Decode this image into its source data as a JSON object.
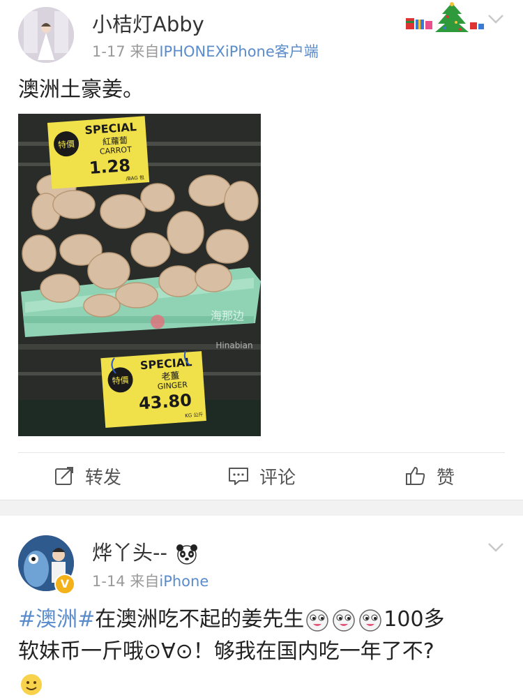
{
  "post1": {
    "username": "小桔灯Abby",
    "date": "1-17",
    "source_prefix": "来自",
    "source": "IPHONEXiPhone客户端",
    "text": "澳洲土豪姜。",
    "photo": {
      "sign_top": {
        "title": "SPECIAL",
        "cn": "紅蘿蔔",
        "en": "CARROT",
        "price": "1.28",
        "unit": "/BAG 包",
        "badge": "特價"
      },
      "sign_bottom": {
        "title": "SPECIAL",
        "cn": "老薑",
        "en": "GINGER",
        "price": "43.80",
        "unit": "KG 公斤",
        "badge": "特價"
      },
      "watermark_cn": "海那边",
      "watermark_en": "Hinabian"
    },
    "actions": {
      "repost": "转发",
      "comment": "评论",
      "like": "赞"
    }
  },
  "post2": {
    "username": "烨丫头--",
    "date": "1-14",
    "source_prefix": "来自",
    "source": "iPhone",
    "hashtag": "#澳洲#",
    "text_line1": "在澳洲吃不起的姜先生",
    "text_line1_tail": "100多",
    "text_line2": "软妹币一斤哦⊙∀⊙！够我在国内吃一年了不?"
  },
  "colors": {
    "link": "#5a8ccc",
    "meta": "#999999",
    "vip": "#f3b11a"
  }
}
